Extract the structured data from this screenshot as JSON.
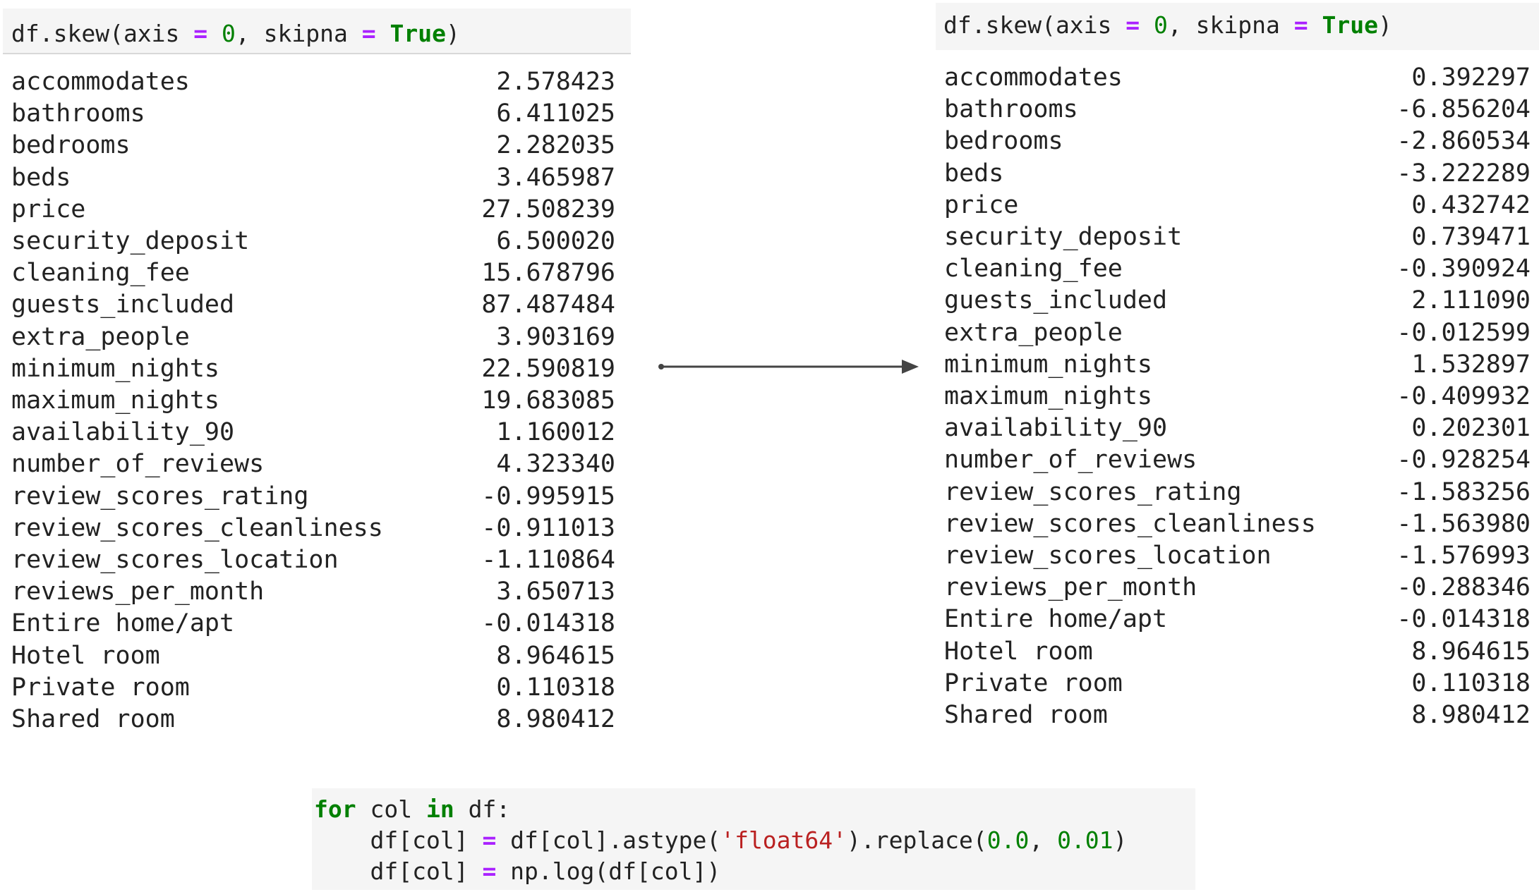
{
  "left_cell": {
    "code": {
      "fn": "df.skew(axis ",
      "eq1": "=",
      "mid1": " ",
      "n0": "0",
      "mid2": ", skipna ",
      "eq2": "=",
      "mid3": " ",
      "true": "True",
      "end": ")"
    },
    "rows": [
      {
        "name": "accommodates",
        "value": "2.578423"
      },
      {
        "name": "bathrooms",
        "value": "6.411025"
      },
      {
        "name": "bedrooms",
        "value": "2.282035"
      },
      {
        "name": "beds",
        "value": "3.465987"
      },
      {
        "name": "price",
        "value": "27.508239"
      },
      {
        "name": "security_deposit",
        "value": "6.500020"
      },
      {
        "name": "cleaning_fee",
        "value": "15.678796"
      },
      {
        "name": "guests_included",
        "value": "87.487484"
      },
      {
        "name": "extra_people",
        "value": "3.903169"
      },
      {
        "name": "minimum_nights",
        "value": "22.590819"
      },
      {
        "name": "maximum_nights",
        "value": "19.683085"
      },
      {
        "name": "availability_90",
        "value": "1.160012"
      },
      {
        "name": "number_of_reviews",
        "value": "4.323340"
      },
      {
        "name": "review_scores_rating",
        "value": "-0.995915"
      },
      {
        "name": "review_scores_cleanliness",
        "value": "-0.911013"
      },
      {
        "name": "review_scores_location",
        "value": "-1.110864"
      },
      {
        "name": "reviews_per_month",
        "value": "3.650713"
      },
      {
        "name": "Entire home/apt",
        "value": "-0.014318"
      },
      {
        "name": "Hotel room",
        "value": "8.964615"
      },
      {
        "name": "Private room",
        "value": "0.110318"
      },
      {
        "name": "Shared room",
        "value": "8.980412"
      }
    ]
  },
  "right_cell": {
    "code": {
      "fn": "df.skew(axis ",
      "eq1": "=",
      "mid1": " ",
      "n0": "0",
      "mid2": ", skipna ",
      "eq2": "=",
      "mid3": " ",
      "true": "True",
      "end": ")"
    },
    "rows": [
      {
        "name": "accommodates",
        "value": "0.392297"
      },
      {
        "name": "bathrooms",
        "value": "-6.856204"
      },
      {
        "name": "bedrooms",
        "value": "-2.860534"
      },
      {
        "name": "beds",
        "value": "-3.222289"
      },
      {
        "name": "price",
        "value": "0.432742"
      },
      {
        "name": "security_deposit",
        "value": "0.739471"
      },
      {
        "name": "cleaning_fee",
        "value": "-0.390924"
      },
      {
        "name": "guests_included",
        "value": "2.111090"
      },
      {
        "name": "extra_people",
        "value": "-0.012599"
      },
      {
        "name": "minimum_nights",
        "value": "1.532897"
      },
      {
        "name": "maximum_nights",
        "value": "-0.409932"
      },
      {
        "name": "availability_90",
        "value": "0.202301"
      },
      {
        "name": "number_of_reviews",
        "value": "-0.928254"
      },
      {
        "name": "review_scores_rating",
        "value": "-1.583256"
      },
      {
        "name": "review_scores_cleanliness",
        "value": "-1.563980"
      },
      {
        "name": "review_scores_location",
        "value": "-1.576993"
      },
      {
        "name": "reviews_per_month",
        "value": "-0.288346"
      },
      {
        "name": "Entire home/apt",
        "value": "-0.014318"
      },
      {
        "name": "Hotel room",
        "value": "8.964615"
      },
      {
        "name": "Private room",
        "value": "0.110318"
      },
      {
        "name": "Shared room",
        "value": "8.980412"
      }
    ]
  },
  "bottom_code": {
    "l1": {
      "kw_for": "for",
      "t1": " col ",
      "kw_in": "in",
      "t2": " df:"
    },
    "l2": {
      "indent": "    ",
      "t1": "df[col] ",
      "op": "=",
      "t2": " df[col].astype(",
      "str": "'float64'",
      "t3": ").replace(",
      "n1": "0.0",
      "t4": ", ",
      "n2": "0.01",
      "t5": ")"
    },
    "l3": {
      "indent": "    ",
      "t1": "df[col] ",
      "op": "=",
      "t2": " np.log(df[col])"
    }
  },
  "colors": {
    "keyword": "#008000",
    "operator": "#aa22ff",
    "string": "#ba2121",
    "cell_bg": "#f5f5f5"
  }
}
